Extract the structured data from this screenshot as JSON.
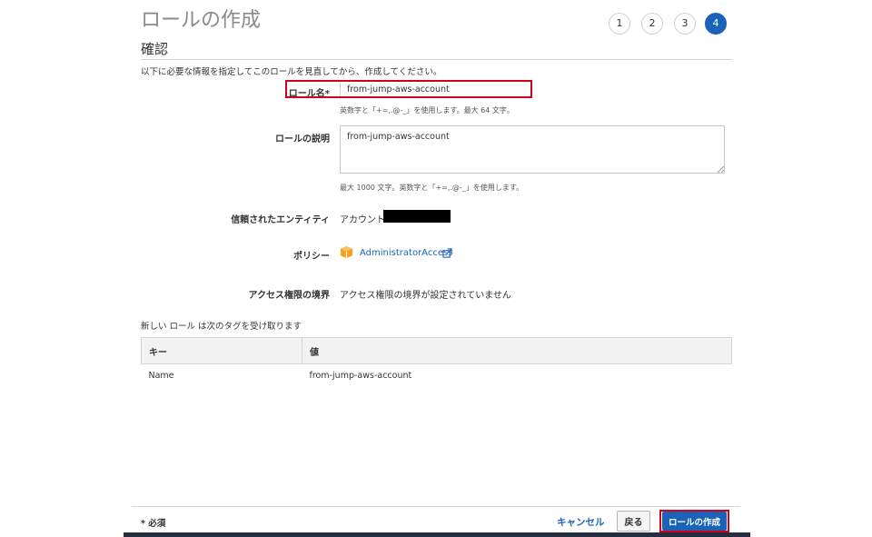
{
  "header": {
    "title": "ロールの作成",
    "steps": [
      "1",
      "2",
      "3",
      "4"
    ],
    "active_step": "4"
  },
  "review": {
    "section_title": "確認",
    "intro": "以下に必要な情報を指定してこのロールを見直してから、作成してください。",
    "role_name": {
      "label": "ロール名*",
      "value": "from-jump-aws-account",
      "hint": "英数字と「+=,.@-_」を使用します。最大 64 文字。"
    },
    "description": {
      "label": "ロールの説明",
      "value": "from-jump-aws-account",
      "hint": "最大 1000 文字。英数字と「+=,.@-_」を使用します。"
    },
    "trusted_entity": {
      "label": "信頼されたエンティティ",
      "value": "アカウント"
    },
    "policy": {
      "label": "ポリシー",
      "link_text": "AdministratorAccess"
    },
    "permissions_boundary": {
      "label": "アクセス権限の境界",
      "value": "アクセス権限の境界が設定されていません"
    }
  },
  "tags": {
    "caption": "新しい ロール は次のタグを受け取ります",
    "columns": [
      "キー",
      "値"
    ],
    "rows": [
      {
        "key": "Name",
        "value": "from-jump-aws-account"
      }
    ]
  },
  "footer": {
    "required_note": "* 必須",
    "cancel_label": "キャンセル",
    "back_label": "戻る",
    "create_label": "ロールの作成"
  },
  "colors": {
    "accent": "#1a63b8",
    "highlight": "#d0021b",
    "policy_icon": "#f7a21c"
  }
}
